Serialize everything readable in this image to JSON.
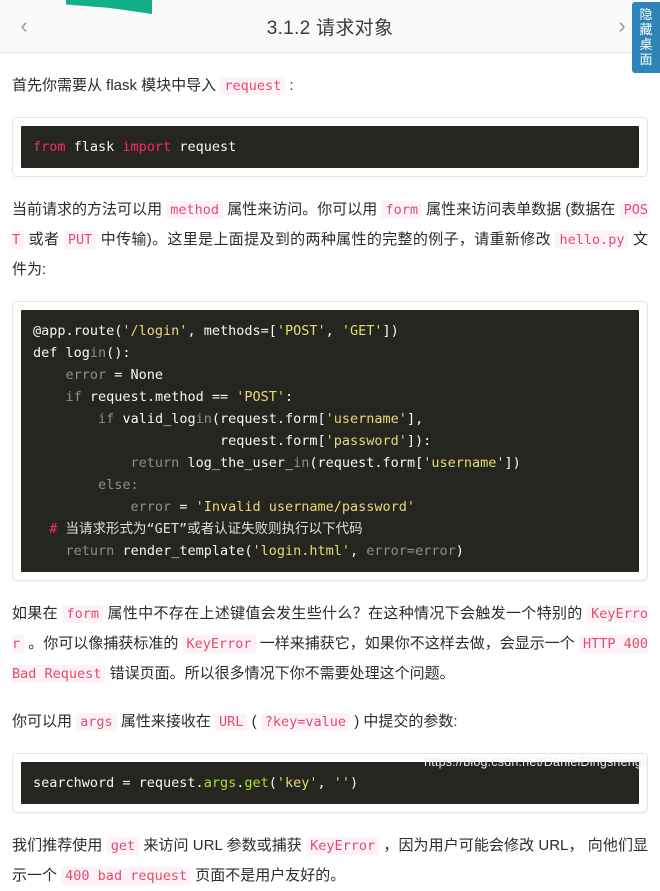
{
  "window": {
    "background": "#ffffff",
    "ribbon_color": "#11b08b"
  },
  "header": {
    "title": "3.1.2 请求对象",
    "prev_icon": "‹",
    "next_icon": "›"
  },
  "side_tab": {
    "chars": [
      "隐",
      "藏",
      "桌",
      "面"
    ],
    "color": "#2e84b6"
  },
  "content": {
    "para1": {
      "seg1": "首先你需要从 flask 模块中导入 ",
      "code1": "request",
      "seg2": " :"
    },
    "code_block_1": {
      "language": "python",
      "tokens": [
        {
          "text": "from",
          "cls": "t-kw"
        },
        {
          "text": " flask ",
          "cls": "t-plain"
        },
        {
          "text": "import",
          "cls": "t-kw"
        },
        {
          "text": " request",
          "cls": "t-plain"
        }
      ],
      "plain": "from flask import request"
    },
    "para2": {
      "seg1": "当前请求的方法可以用 ",
      "code1": "method",
      "seg2": " 属性来访问。你可以用 ",
      "code2": "form",
      "seg3": " 属性来访问表单数据 (数据在 ",
      "code3": "POST",
      "seg4": " 或者 ",
      "code4": "PUT",
      "seg5": " 中传输)。这里是上面提及到的两种属性的完整的例子，请重新修改 ",
      "code5": "hello.py",
      "seg6": " 文件为:"
    },
    "code_block_2": {
      "language": "python",
      "lines": [
        "@app.route('/login', methods=['POST', 'GET'])",
        "def login():",
        "    error = None",
        "    if request.method == 'POST':",
        "        if valid_login(request.form['username'],",
        "                       request.form['password']):",
        "            return log_the_user_in(request.form['username'])",
        "        else:",
        "            error = 'Invalid username/password'",
        "  # 当请求形式为“GET”或者认证失败则执行以下代码",
        "    return render_template('login.html', error=error)"
      ]
    },
    "para3": {
      "seg1": "如果在 ",
      "code1": "form",
      "seg2": " 属性中不存在上述键值会发生些什么？在这种情况下会触发一个特别的 ",
      "code2": "KeyError",
      "seg3": " 。你可以像捕获标准的 ",
      "code3": "KeyError",
      "seg4": " 一样来捕获它，如果你不这样去做，会显示一个 ",
      "code4": "HTTP 400 Bad Request",
      "seg5": " 错误页面。所以很多情况下你不需要处理这个问题。"
    },
    "para4": {
      "seg1": "你可以用 ",
      "code1": "args",
      "seg2": " 属性来接收在 ",
      "code2": "URL",
      "seg3": " ( ",
      "code3": "?key=value",
      "seg4": " ) 中提交的参数:"
    },
    "code_block_3": {
      "language": "python",
      "plain": "searchword = request.args.get('key', '')"
    },
    "para5": {
      "seg1": "我们推荐使用 ",
      "code1": "get",
      "seg2": " 来访问 URL 参数或捕获 ",
      "code2": "KeyError",
      "seg3": " ，因为用户可能会修改 URL， 向他们显示一个 ",
      "code3": "400 bad request",
      "seg4": " 页面不是用户友好的。"
    }
  },
  "watermark": {
    "text": "https://blog.csdn.net/DanielDingshengli"
  }
}
